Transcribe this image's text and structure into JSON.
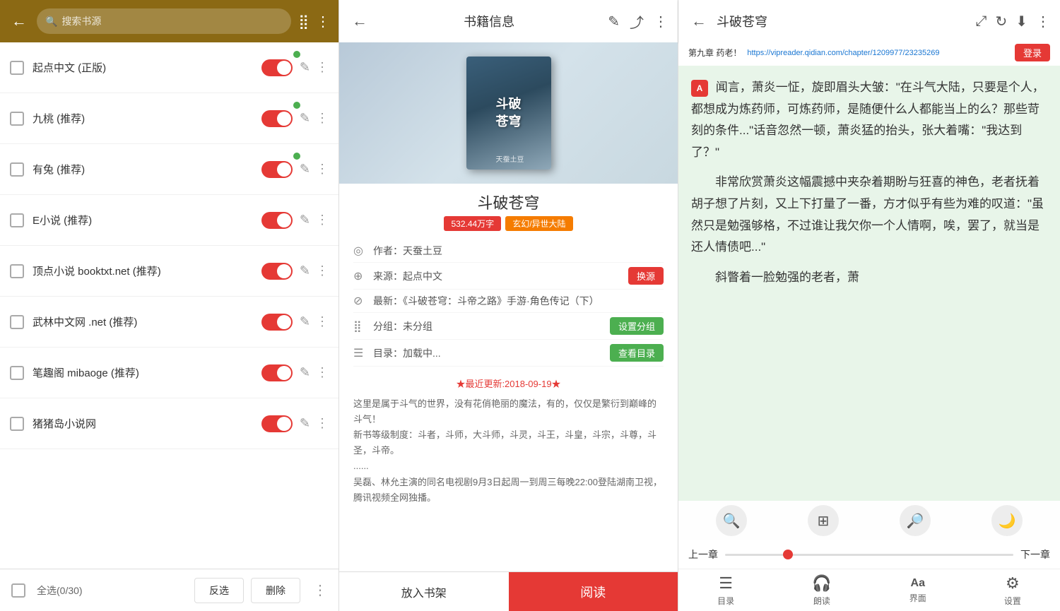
{
  "panel1": {
    "back_icon": "←",
    "search_placeholder": "搜索书源",
    "qr_icon": "⣿",
    "more_icon": "⋮",
    "sources": [
      {
        "name": "起点中文 (正版)",
        "has_dot": true
      },
      {
        "name": "九桃 (推荐)",
        "has_dot": true
      },
      {
        "name": "有兔 (推荐)",
        "has_dot": true
      },
      {
        "name": "E小说 (推荐)",
        "has_dot": false
      },
      {
        "name": "顶点小说 booktxt.net (推荐)",
        "has_dot": false
      },
      {
        "name": "武林中文网 .net (推荐)",
        "has_dot": false
      },
      {
        "name": "笔趣阁 mibaoge (推荐)",
        "has_dot": false
      },
      {
        "name": "猪猪岛小说网",
        "has_dot": false
      }
    ],
    "footer": {
      "select_all_label": "全选(0/30)",
      "reverse_btn": "反选",
      "delete_btn": "删除"
    }
  },
  "panel2": {
    "back_icon": "←",
    "title": "书籍信息",
    "edit_icon": "✎",
    "share_icon": "⤴",
    "more_icon": "⋮",
    "book_title_cover": "斗破苍穹",
    "book_cover_sub": "天蚕土豆",
    "book_title": "斗破苍穹",
    "tag_words": "532.44万字",
    "tag_genre1": "玄幻/异世大陆",
    "meta": [
      {
        "icon": "◎",
        "label": "作者：天蚕土豆"
      },
      {
        "icon": "⊕",
        "label": "来源：起点中文",
        "btn": "换源"
      },
      {
        "icon": "⊘",
        "label": "最新：《斗破苍穹：斗帝之路》手游·角色传记（下）"
      },
      {
        "icon": "⣿",
        "label": "分组：未分组",
        "btn2": "设置分组"
      },
      {
        "icon": "☰",
        "label": "目录：加载中...",
        "btn3": "查看目录"
      }
    ],
    "desc_update": "★最近更新:2018-09-19★",
    "desc_body": "这里是属于斗气的世界，没有花俏艳丽的魔法，有的，仅仅是繁衍到巅峰的斗气！\n新书等级制度：斗者，斗师，大斗师，斗灵，斗王，斗皇，斗宗，斗尊，斗圣，斗帝。\n......\n吴磊、林允主演的同名电视剧9月3日起周一到周三每晚22:00登陆湖南卫视，腾讯视频全网独播。",
    "footer": {
      "shelf_btn": "放入书架",
      "read_btn": "阅读"
    }
  },
  "panel3": {
    "back_icon": "←",
    "title": "斗破苍穹",
    "tts_icon": "⤢",
    "refresh_icon": "↻",
    "download_icon": "⬇",
    "more_icon": "⋮",
    "chapter_label": "第九章 药老！",
    "url": "https://vipreader.qidian.com/chapter/1209977/23235269",
    "login_btn": "登录",
    "content_para1": "闻言，萧炎一怔，旋即眉头大皱：\"在斗气大陆，只要是个人，都想成为炼药师，可炼药师，是随便什么人都能当上的么？那些苛刻的条件...\"话音忽然一顿，萧炎猛的抬头，张大着嘴：\"我达到了？\"",
    "content_para2": "非常欣赏萧炎这幅震撼中夹杂着期盼与狂喜的神色，老者抚着胡子想了片刻，又上下打量了一番，方才似乎有些为难的叹道：\"虽然只是勉强够格，不过谁让我欠你一个人情啊，唉，罢了，就当是还人情债吧...\"",
    "content_para3": "斜瞥着一脸勉强的老者，萧",
    "author_icon_label": "A",
    "toolbar": {
      "search_icon": "🔍",
      "translate_icon": "⊞",
      "zoom_icon": "🔎",
      "moon_icon": "🌙"
    },
    "progress": {
      "prev_label": "上一章",
      "next_label": "下一章"
    },
    "bottom_nav": [
      {
        "icon": "☰",
        "label": "目录"
      },
      {
        "icon": "🎧",
        "label": "朗读"
      },
      {
        "icon": "Aa",
        "label": "界面"
      },
      {
        "icon": "⚙",
        "label": "设置"
      }
    ]
  }
}
